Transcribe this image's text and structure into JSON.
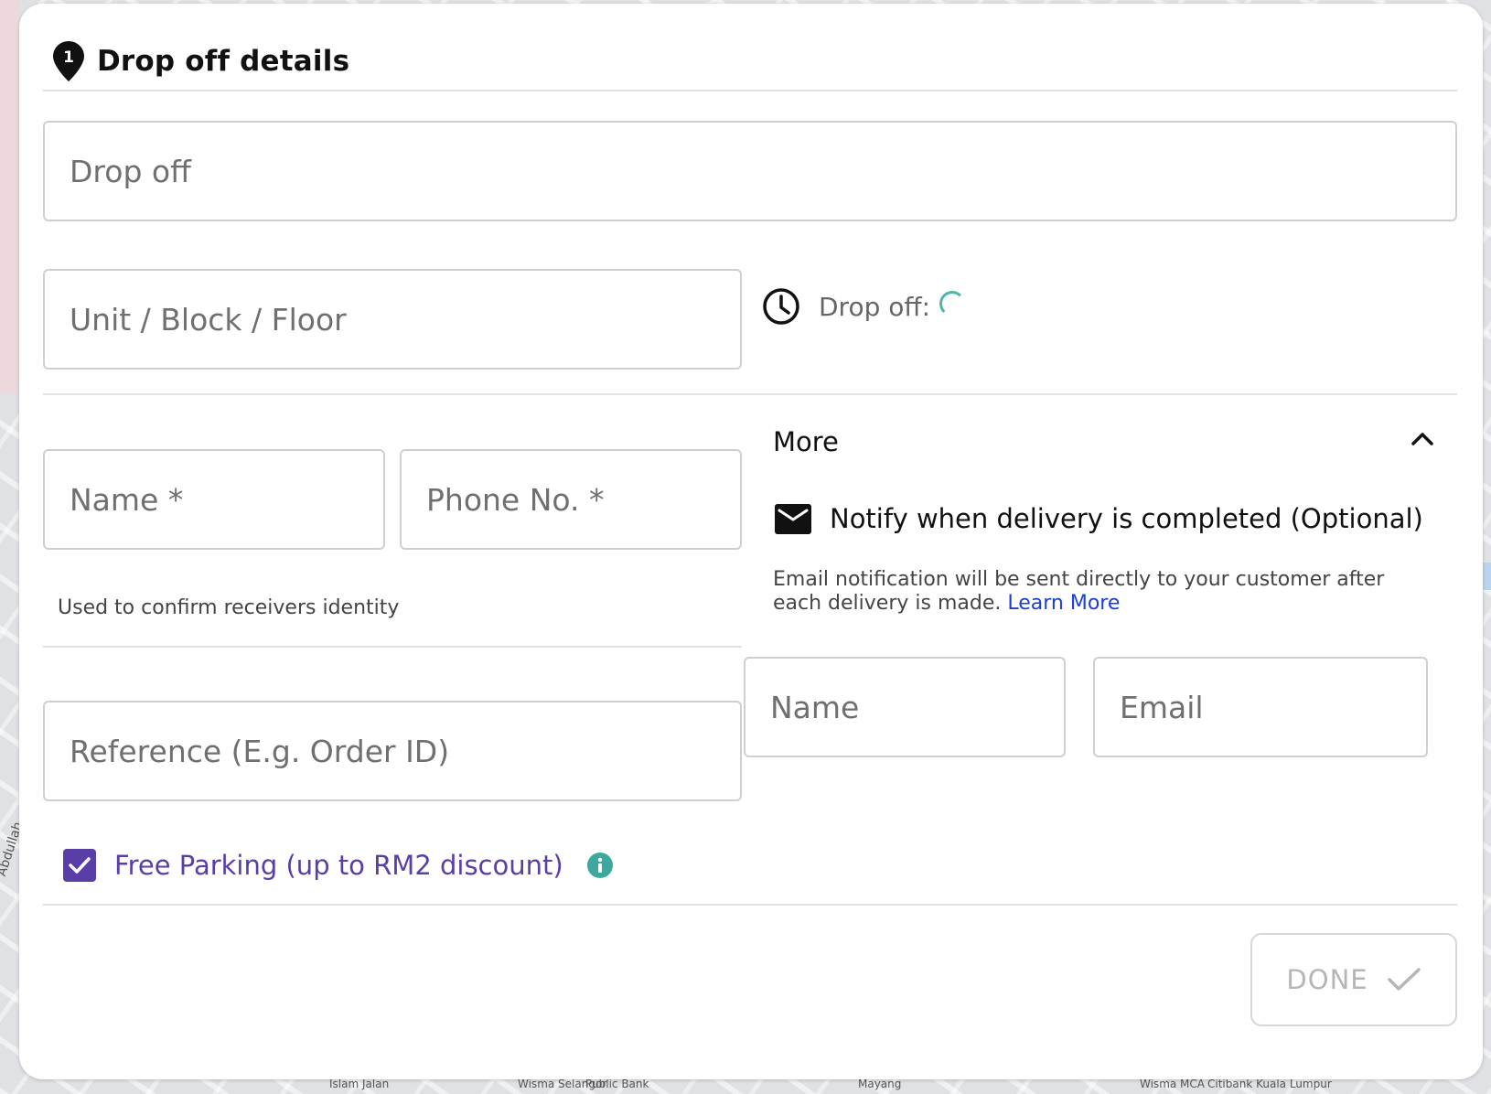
{
  "map": {
    "labels": [
      "Islam Jalan",
      "Wisma Selangor",
      "Public Bank",
      "Mayang",
      "Wisma MCA",
      "Citibank Kuala Lumpur"
    ],
    "side_label": "Abdullah"
  },
  "dialog": {
    "step_number": "1",
    "title": "Drop off details",
    "drop_off_placeholder": "Drop off",
    "unit_placeholder": "Unit / Block / Floor",
    "eta_label": "Drop off:",
    "name_placeholder": "Name *",
    "phone_placeholder": "Phone No. *",
    "identity_hint": "Used to confirm receivers identity",
    "reference_placeholder": "Reference (E.g. Order ID)",
    "free_parking": {
      "label": "Free Parking (up to RM2 discount)",
      "checked": true
    },
    "more": {
      "label": "More",
      "expanded": true,
      "notify_label": "Notify when delivery is completed (Optional)",
      "note_text": "Email notification will be sent directly to your customer after each delivery is made.",
      "learn_more": "Learn More",
      "name_placeholder": "Name",
      "email_placeholder": "Email"
    },
    "done_label": "DONE"
  },
  "colors": {
    "accent_purple": "#5a3ea8",
    "spinner_teal": "#4fb5ad",
    "info_teal": "#3fa89e",
    "link_blue": "#1a3fd6"
  },
  "icons": {
    "step": "map-pin-icon",
    "eta": "clock-icon",
    "more": "chevron-up-icon",
    "notify": "mail-icon",
    "info": "info-icon",
    "done": "check-icon"
  }
}
